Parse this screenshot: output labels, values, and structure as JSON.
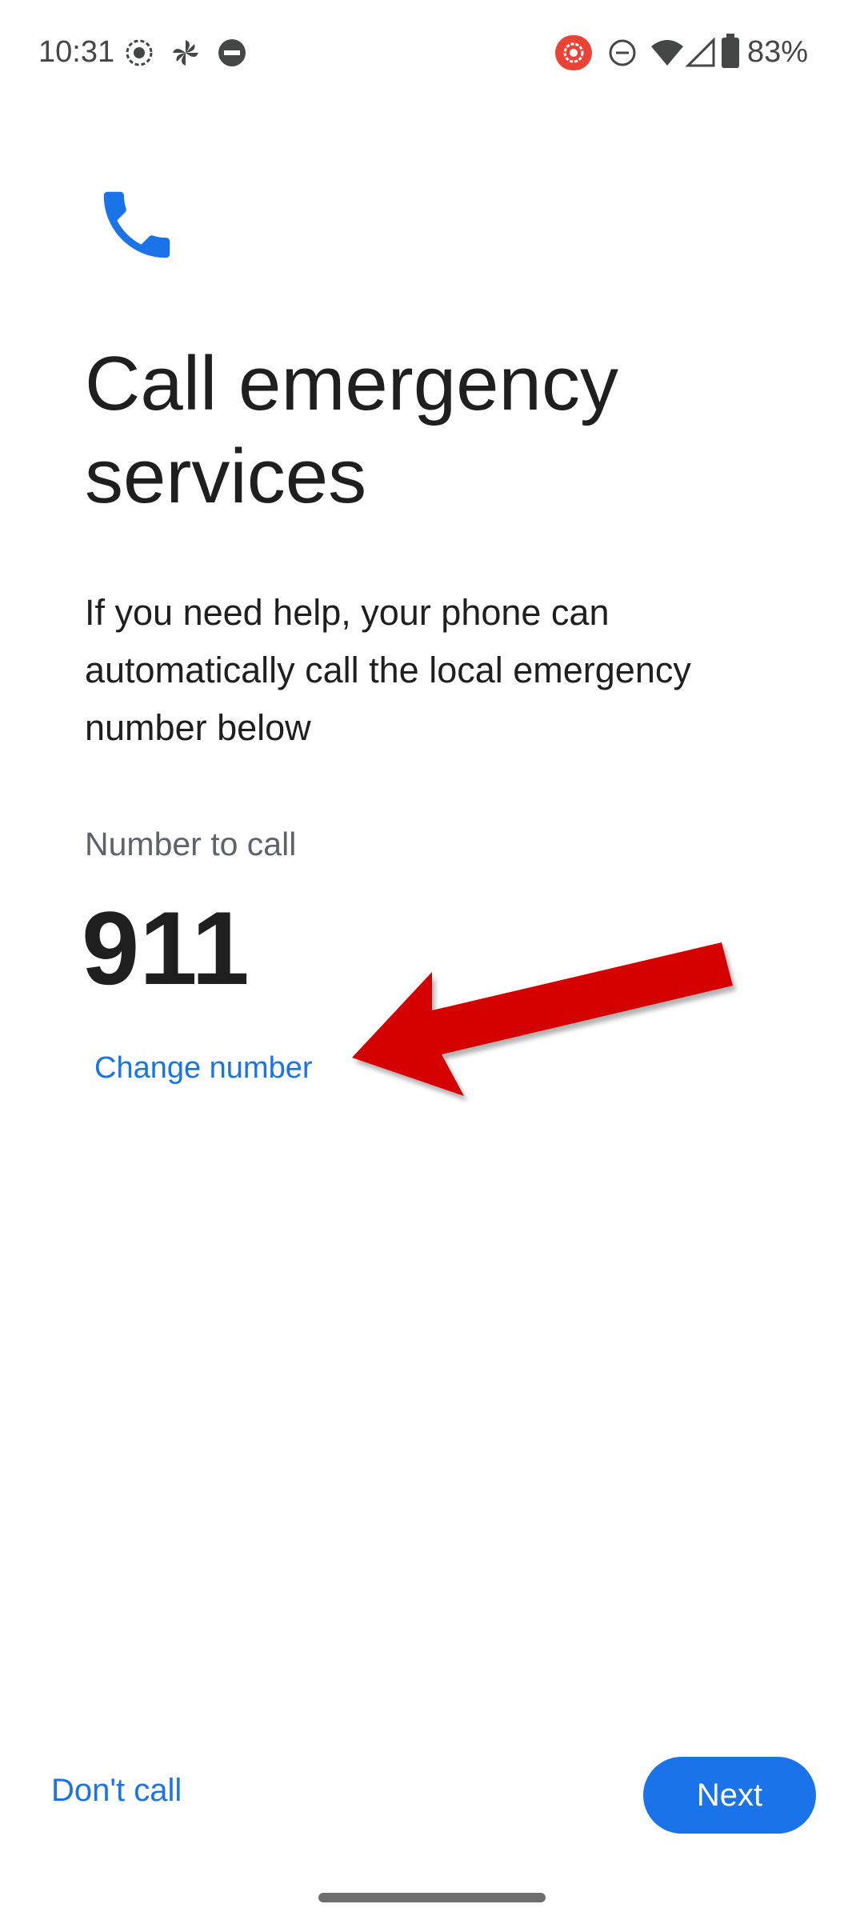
{
  "status_bar": {
    "time": "10:31",
    "battery_percent": "83%",
    "icons_left": [
      "screen-record-icon",
      "pinwheel-icon",
      "dnd-icon"
    ],
    "icons_right": [
      "recording-indicator-icon",
      "dnd-outline-icon",
      "wifi-icon",
      "signal-icon",
      "battery-icon"
    ]
  },
  "main": {
    "icon": "phone-icon",
    "title": "Call emergency services",
    "description": "If you need help, your phone can automatically call the local emergency number below",
    "number_label": "Number to call",
    "number": "911",
    "change_number_label": "Change number"
  },
  "footer": {
    "dont_call_label": "Don't call",
    "next_label": "Next"
  },
  "colors": {
    "accent": "#1a73e8",
    "text_primary": "#1f1f1f",
    "text_secondary": "#5f6368",
    "annotation_arrow": "#d50000",
    "recording_indicator": "#ea4335"
  }
}
